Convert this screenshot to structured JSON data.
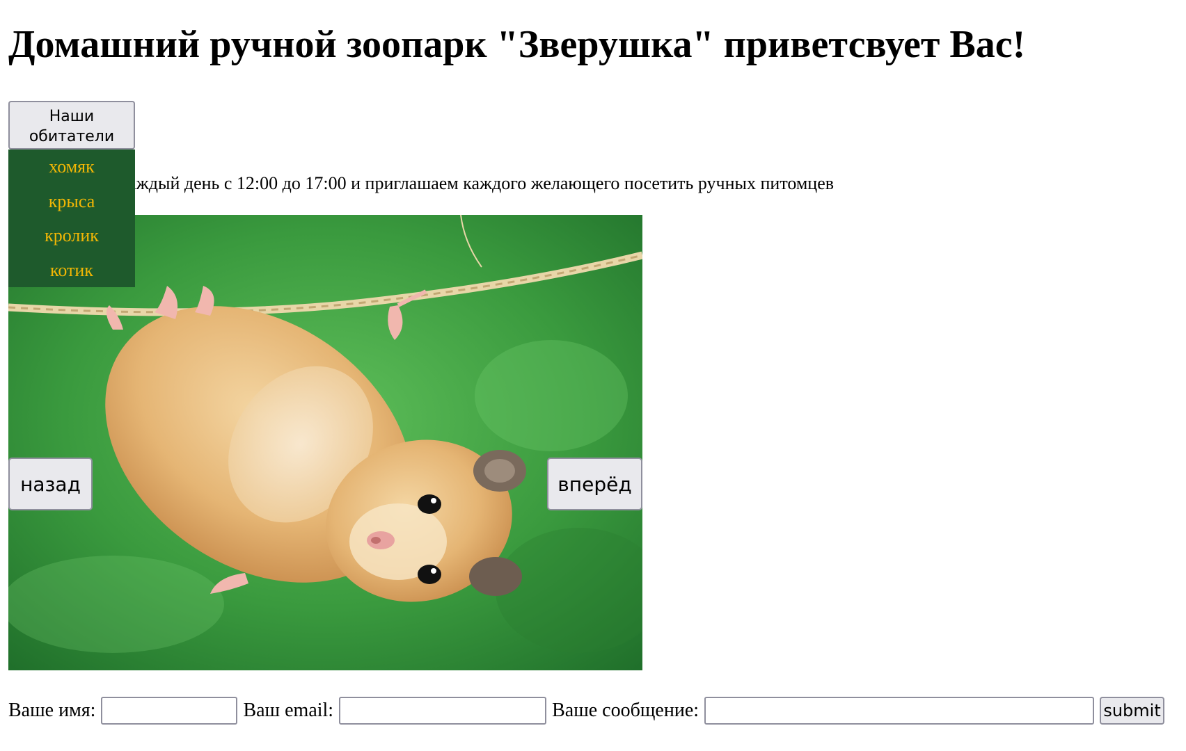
{
  "header": {
    "title": "Домашний ручной зоопарк \"Зверушка\" приветсвует Вас!"
  },
  "menu": {
    "button_label_line1": "Наши",
    "button_label_line2": "обитатели",
    "items": [
      {
        "label": "хомяк"
      },
      {
        "label": "крыса"
      },
      {
        "label": "кролик"
      },
      {
        "label": "котик"
      }
    ]
  },
  "intro": {
    "visible_text": "каждый день с 12:00 до 17:00 и приглашаем каждого желающего посетить ручных питомцев"
  },
  "gallery": {
    "back_label": "назад",
    "forward_label": "вперёд",
    "image_subject": "hamster-hanging-on-rope"
  },
  "form": {
    "name_label": "Ваше имя:",
    "name_value": "",
    "email_label": "Ваш email:",
    "email_value": "",
    "message_label": "Ваше сообщение:",
    "message_value": "",
    "submit_label": "submit"
  },
  "colors": {
    "dropdown_bg": "#1e5a2c",
    "dropdown_text": "#f2b705"
  }
}
